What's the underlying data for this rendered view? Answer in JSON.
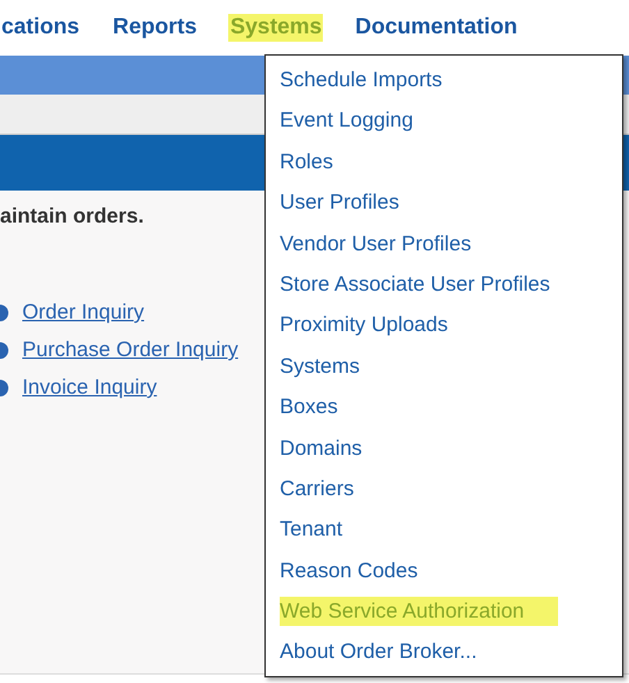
{
  "nav": [
    {
      "label": "cations",
      "highlighted": false
    },
    {
      "label": "Reports",
      "highlighted": false
    },
    {
      "label": "Systems",
      "highlighted": true
    },
    {
      "label": "Documentation",
      "highlighted": false
    }
  ],
  "content": {
    "intro": "aintain orders.",
    "links": [
      "Order Inquiry",
      "Purchase Order Inquiry",
      "Invoice Inquiry"
    ]
  },
  "menu": [
    {
      "label": "Schedule Imports",
      "highlighted": false
    },
    {
      "label": "Event Logging",
      "highlighted": false
    },
    {
      "label": "Roles",
      "highlighted": false
    },
    {
      "label": "User Profiles",
      "highlighted": false
    },
    {
      "label": "Vendor User Profiles",
      "highlighted": false
    },
    {
      "label": "Store Associate User Profiles",
      "highlighted": false
    },
    {
      "label": "Proximity Uploads",
      "highlighted": false
    },
    {
      "label": "Systems",
      "highlighted": false
    },
    {
      "label": "Boxes",
      "highlighted": false
    },
    {
      "label": "Domains",
      "highlighted": false
    },
    {
      "label": "Carriers",
      "highlighted": false
    },
    {
      "label": "Tenant",
      "highlighted": false
    },
    {
      "label": "Reason Codes",
      "highlighted": false
    },
    {
      "label": "Web Service Authorization",
      "highlighted": true
    },
    {
      "label": "About Order Broker...",
      "highlighted": false
    }
  ]
}
